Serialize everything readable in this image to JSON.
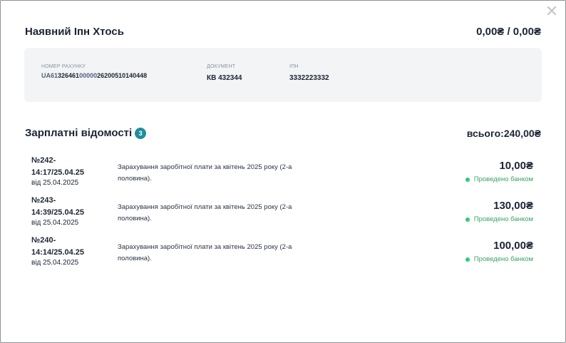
{
  "modal": {
    "close_glyph": "✕",
    "title": "Наявний Іпн Хтось",
    "balance": "0,00₴ / 0,00₴"
  },
  "info": {
    "account_label": "НОМЕР РАХУНКУ",
    "account_prefix": "UA61",
    "account_seg1": "326461",
    "account_seg2": "00000",
    "account_seg3": "26200510140448",
    "document_label": "ДОКУМЕНТ",
    "document_value": "КВ 432344",
    "ipn_label": "ІПН",
    "ipn_value": "3332223332"
  },
  "payroll": {
    "title": "Зарплатні відомості",
    "count": "3",
    "total": "всього:240,00₴",
    "items": [
      {
        "number": "№242-",
        "time": "14:17/25.04.25",
        "date": "від 25.04.2025",
        "description": "Зарахування заробітної плати за квітень 2025 року (2-а половина).",
        "amount": "10,00₴",
        "status": "Проведено банком"
      },
      {
        "number": "№243-",
        "time": "14:39/25.04.25",
        "date": "від 25.04.2025",
        "description": "Зарахування заробітної плати за квітень 2025 року (2-а половина).",
        "amount": "130,00₴",
        "status": "Проведено банком"
      },
      {
        "number": "№240-",
        "time": "14:14/25.04.25",
        "date": "від 25.04.2025",
        "description": "Зарахування заробітної плати за квітень 2025 року (2-а половина).",
        "amount": "100,00₴",
        "status": "Проведено банком"
      }
    ]
  },
  "colors": {
    "accent": "#1e8e9e",
    "status_green": "#3aa55f",
    "panel_bg": "#f2f4f6"
  }
}
